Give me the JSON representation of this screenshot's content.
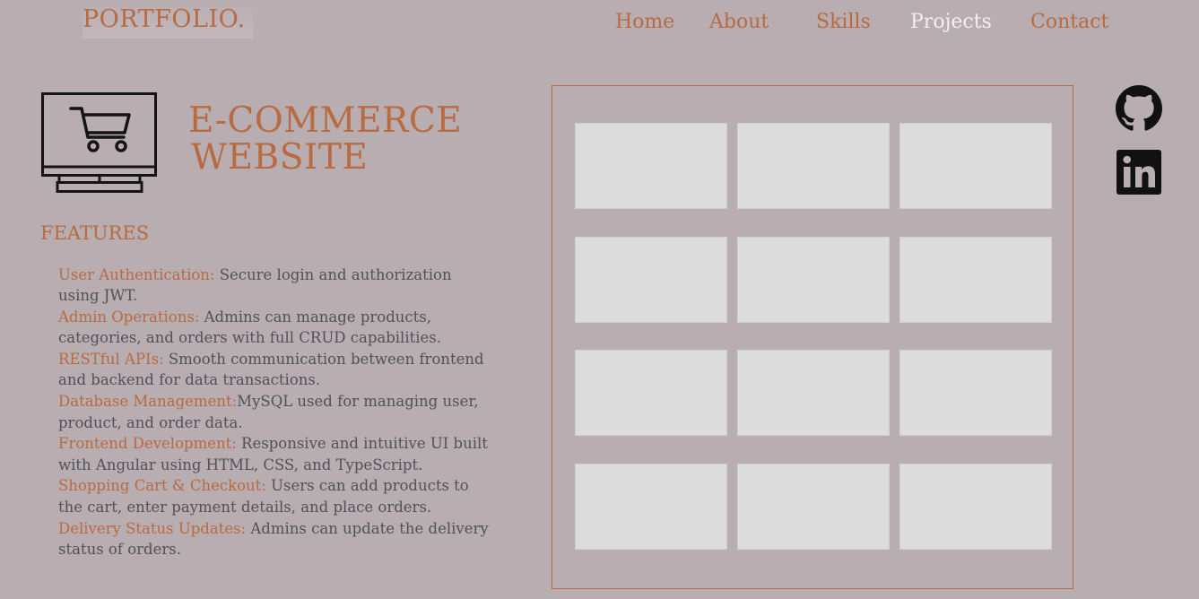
{
  "brand": {
    "text": "PORTFOLIO."
  },
  "nav": {
    "items": [
      {
        "label": "Home"
      },
      {
        "label": "About"
      },
      {
        "label": "Skills"
      },
      {
        "label": "Projects"
      },
      {
        "label": "Contact"
      }
    ],
    "active": "Projects"
  },
  "project": {
    "title_line1": "E-COMMERCE",
    "title_line2": "WEBSITE",
    "icon": "monitor-cart-icon",
    "features_heading": "FEATURES",
    "features": [
      {
        "key": "User Authentication:",
        "text": " Secure login and authorization using JWT."
      },
      {
        "key": "Admin Operations:",
        "text": " Admins can manage products, categories, and orders with full CRUD capabilities."
      },
      {
        "key": "RESTful APIs:",
        "text": " Smooth communication between frontend and backend for data transactions."
      },
      {
        "key": "Database Management:",
        "text": "MySQL used for managing user, product, and order data."
      },
      {
        "key": "Frontend Development:",
        "text": " Responsive and intuitive UI built with Angular using HTML, CSS, and TypeScript."
      },
      {
        "key": "Shopping Cart & Checkout:",
        "text": " Users can add products to the cart, enter payment details, and place orders."
      },
      {
        "key": "Delivery Status Updates:",
        "text": " Admins can update the delivery status of orders."
      }
    ]
  },
  "gallery": {
    "rows": 4,
    "cols": 3
  },
  "social": [
    {
      "icon": "github-icon"
    },
    {
      "icon": "linkedin-icon"
    }
  ],
  "colors": {
    "background": "#b8adb0",
    "accent": "#b86a40",
    "body_text": "#4e5358",
    "nav_active": "#f4f0f1",
    "thumbnail": "#dcdcdc",
    "icon": "#111111"
  }
}
